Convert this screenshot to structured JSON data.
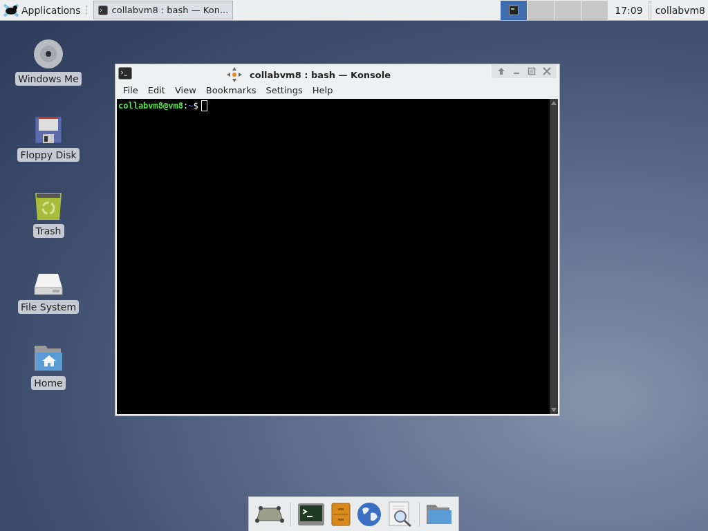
{
  "panel": {
    "apps_menu": "Applications",
    "tasks": [
      {
        "title": "collabvm8 : bash — Kon...",
        "selected": true
      }
    ],
    "workspaces": [
      {
        "selected": true
      },
      {
        "selected": false
      },
      {
        "selected": false
      },
      {
        "selected": false
      }
    ],
    "clock": "17:09",
    "user": "collabvm8"
  },
  "desktop_icons": [
    {
      "kind": "disc",
      "label": "Windows Me"
    },
    {
      "kind": "floppy",
      "label": "Floppy Disk"
    },
    {
      "kind": "trash",
      "label": "Trash"
    },
    {
      "kind": "drive",
      "label": "File System"
    },
    {
      "kind": "home",
      "label": "Home"
    }
  ],
  "window": {
    "title": "collabvm8 : bash — Konsole",
    "menu": [
      "File",
      "Edit",
      "View",
      "Bookmarks",
      "Settings",
      "Help"
    ],
    "prompt": {
      "user_host": "collabvm8@vm8",
      "separator": ":",
      "path": "~",
      "symbol": "$"
    }
  },
  "dock": [
    {
      "kind": "desktop"
    },
    {
      "kind": "terminal"
    },
    {
      "kind": "cabinet"
    },
    {
      "kind": "globe"
    },
    {
      "kind": "search"
    },
    {
      "kind": "folder"
    }
  ]
}
